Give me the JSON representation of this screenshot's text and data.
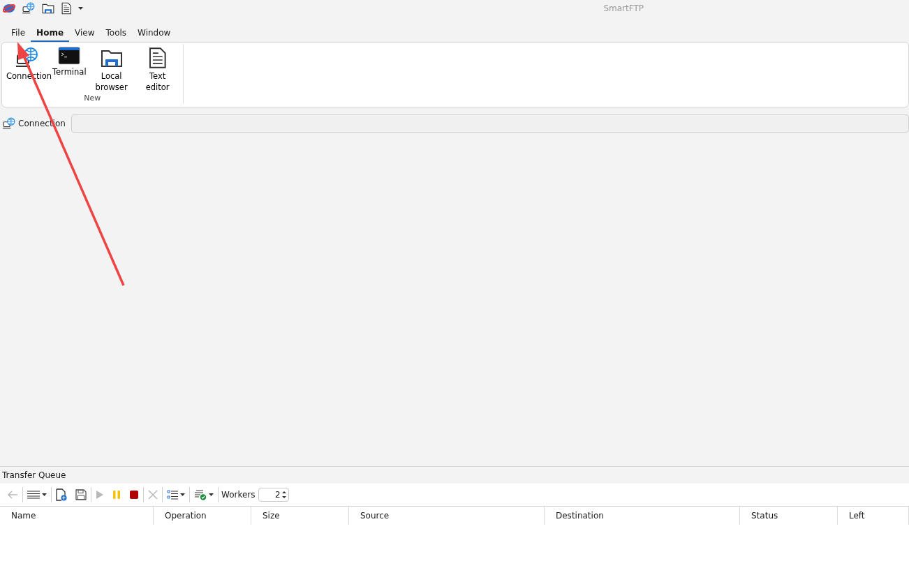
{
  "window": {
    "title": "SmartFTP"
  },
  "quick_access": [
    {
      "kind": "connection"
    },
    {
      "kind": "folder"
    },
    {
      "kind": "document"
    },
    {
      "kind": "more"
    }
  ],
  "menu_tabs": [
    {
      "label": "File",
      "selected": false
    },
    {
      "label": "Home",
      "selected": true
    },
    {
      "label": "View",
      "selected": false
    },
    {
      "label": "Tools",
      "selected": false
    },
    {
      "label": "Window",
      "selected": false
    }
  ],
  "ribbon": {
    "group_label": "New",
    "buttons": [
      {
        "kind": "connection",
        "label": "Connection"
      },
      {
        "kind": "terminal",
        "label": "Terminal"
      },
      {
        "kind": "folder",
        "label": "Local browser"
      },
      {
        "kind": "document",
        "label": "Text editor"
      }
    ]
  },
  "address_bar": {
    "label": "Connection"
  },
  "transfer_queue": {
    "title": "Transfer Queue",
    "toolbar": [
      {
        "kind": "back",
        "disabled": true
      },
      {
        "kind": "list",
        "disabled": false
      },
      {
        "kind": "new-file",
        "disabled": false
      },
      {
        "kind": "save",
        "disabled": false
      },
      {
        "kind": "play",
        "disabled": true
      },
      {
        "kind": "pause",
        "disabled": false
      },
      {
        "kind": "stop",
        "disabled": false
      },
      {
        "kind": "delete",
        "disabled": true
      },
      {
        "kind": "select-list",
        "disabled": false
      },
      {
        "kind": "check-list",
        "disabled": false
      }
    ],
    "workers": {
      "label": "Workers",
      "value": "2"
    },
    "columns": [
      "Name",
      "Operation",
      "Size",
      "Source",
      "Destination",
      "Status",
      "Left"
    ]
  },
  "annotation": {
    "kind": "arrow"
  }
}
